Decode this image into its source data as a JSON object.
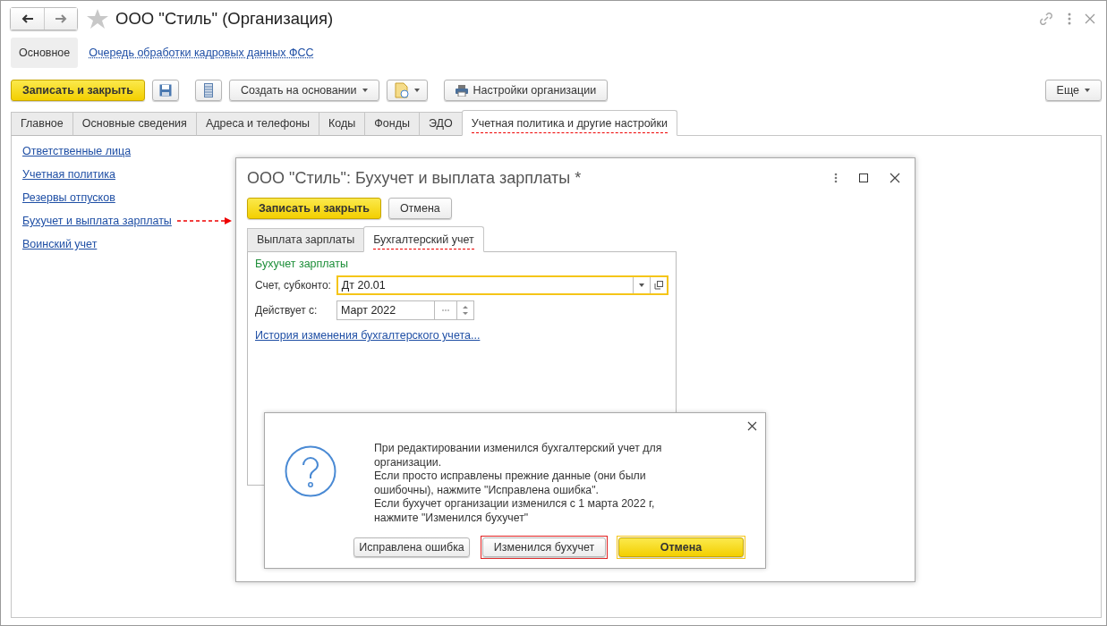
{
  "window": {
    "title": "ООО \"Стиль\" (Организация)"
  },
  "sections": [
    {
      "label": "Основное",
      "selected": true
    },
    {
      "label": "Очередь обработки кадровых данных ФСС",
      "selected": false
    }
  ],
  "toolbar": {
    "save_close": "Записать и закрыть",
    "create_based": "Создать на основании",
    "settings": "Настройки организации",
    "more": "Еще"
  },
  "tabs": [
    {
      "label": "Главное",
      "selected": false,
      "highlighted": false
    },
    {
      "label": "Основные сведения",
      "selected": false,
      "highlighted": false
    },
    {
      "label": "Адреса и телефоны",
      "selected": false,
      "highlighted": false
    },
    {
      "label": "Коды",
      "selected": false,
      "highlighted": false
    },
    {
      "label": "Фонды",
      "selected": false,
      "highlighted": false
    },
    {
      "label": "ЭДО",
      "selected": false,
      "highlighted": false
    },
    {
      "label": "Учетная политика и другие настройки",
      "selected": true,
      "highlighted": true
    }
  ],
  "links": [
    {
      "label": "Ответственные лица",
      "highlighted": false
    },
    {
      "label": "Учетная политика",
      "highlighted": false
    },
    {
      "label": "Резервы отпусков",
      "highlighted": false
    },
    {
      "label": "Бухучет и выплата зарплаты",
      "highlighted": true
    },
    {
      "label": "Воинский учет",
      "highlighted": false
    }
  ],
  "dialog": {
    "title": "ООО \"Стиль\": Бухучет и выплата зарплаты *",
    "save_close": "Записать и закрыть",
    "cancel": "Отмена",
    "tabs": [
      {
        "label": "Выплата зарплаты",
        "selected": false,
        "highlighted": false
      },
      {
        "label": "Бухгалтерский учет",
        "selected": true,
        "highlighted": true
      }
    ],
    "group_title": "Бухучет зарплаты",
    "fields": [
      {
        "kind": "select",
        "label": "Счет, субконто:",
        "value": "Дт 20.01",
        "focused": true
      },
      {
        "kind": "period",
        "label": "Действует с:",
        "value": "Март 2022",
        "focused": false
      }
    ],
    "history_link": "История изменения бухгалтерского учета..."
  },
  "message": {
    "paragraphs": [
      "При редактировании изменился бухгалтерский учет для организации.",
      "Если просто исправлены прежние данные (они были ошибочны), нажмите \"Исправлена ошибка\".",
      "Если бухучет организации изменился с 1 марта 2022 г, нажмите \"Изменился бухучет\""
    ],
    "buttons": [
      {
        "label": "Исправлена ошибка",
        "kind": "plain",
        "highlighted": false
      },
      {
        "label": "Изменился бухучет",
        "kind": "plain",
        "highlighted": true
      },
      {
        "label": "Отмена",
        "kind": "default",
        "highlighted": false
      }
    ]
  }
}
